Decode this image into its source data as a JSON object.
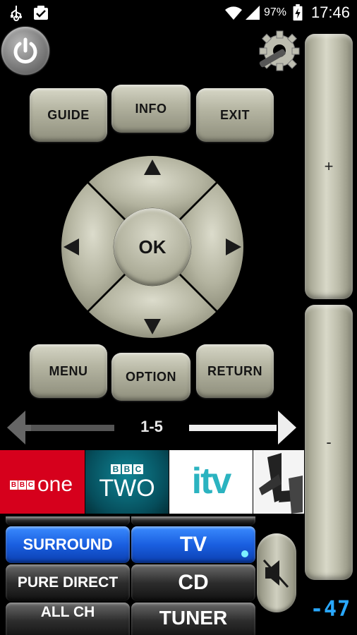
{
  "status_bar": {
    "battery_percent": "97%",
    "time": "17:46",
    "icons": [
      "usb-icon",
      "download-check-icon",
      "wifi-icon",
      "cellular-signal-icon",
      "battery-charging-icon"
    ]
  },
  "top_buttons": {
    "guide": "GUIDE",
    "info": "INFO",
    "exit": "EXIT"
  },
  "dpad": {
    "ok": "OK"
  },
  "bottom_buttons": {
    "menu": "MENU",
    "option": "OPTION",
    "return": "RETURN"
  },
  "volume": {
    "plus": "+",
    "minus": "-",
    "level": "-47"
  },
  "page_nav": {
    "label": "1-5"
  },
  "channels": [
    {
      "name": "BBC ONE",
      "bbc": "BBC",
      "word": "one"
    },
    {
      "name": "BBC TWO",
      "bbc": "BBC",
      "word": "TWO"
    },
    {
      "name": "ITV",
      "word": "itv"
    },
    {
      "name": "Channel 4",
      "word": "4"
    }
  ],
  "inputs": {
    "surround": "SURROUND",
    "tv": "TV",
    "pure_direct": "PURE DIRECT",
    "cd": "CD",
    "all_ch": "ALL CH",
    "tuner": "TUNER"
  },
  "colors": {
    "button_face": "#b5b5a2",
    "accent_blue": "#1a5fe0",
    "level_blue": "#29a8ff",
    "bbc_one_red": "#d6001c",
    "bbc_two_teal": "#0a6b7a"
  }
}
